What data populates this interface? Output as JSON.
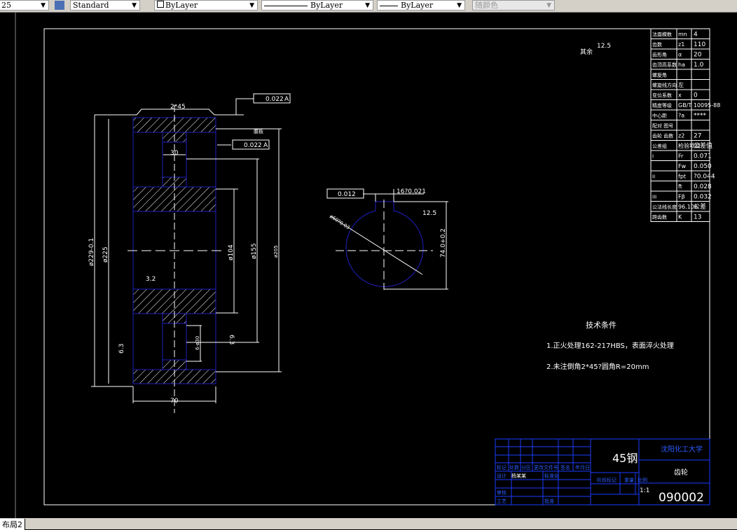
{
  "toolbar": {
    "lineweight_value": "25",
    "text_style": "Standard",
    "layer": "ByLayer",
    "linetype": "ByLayer",
    "lineweight": "ByLayer",
    "color": "随颜色"
  },
  "layout_tab": "布局2",
  "drawing": {
    "chamfer": "2*45",
    "tol1": "0.022",
    "datum": "A",
    "tol2": "0.022",
    "web_label": "腹板",
    "dim_30": "30",
    "dim_229": "ø229-0.1",
    "dim_225": "ø225",
    "dim_104": "ø104",
    "dim_155": "ø155",
    "dim_205": "ø205",
    "dim_70": "70",
    "dim_6": "6-ø30",
    "rough_32": "3.2",
    "rough_63a": "6.3",
    "rough_63b": "6.3",
    "rough_other": "其余",
    "rough_125": "12.5",
    "sym_tol": "0.012",
    "key_width": "16?0.021",
    "bore": "ø60?0.03",
    "key_depth": "74.0+0.2",
    "rough_125b": "12.5"
  },
  "params": [
    [
      "法面模数",
      "mn",
      "4"
    ],
    [
      "齿数",
      "z1",
      "110"
    ],
    [
      "齿形角",
      "α",
      "20"
    ],
    [
      "齿顶高系数",
      "ha",
      "1.0"
    ],
    [
      "螺旋角",
      "",
      ""
    ],
    [
      "螺旋线方向",
      "左",
      ""
    ],
    [
      "变位系数",
      "x",
      "0"
    ],
    [
      "精度等级",
      "GB/T 10095-88",
      ""
    ],
    [
      "中心距",
      "?a",
      "****"
    ],
    [
      "配对 图号",
      "",
      ""
    ],
    [
      "齿轮 齿数",
      "z2",
      "27"
    ],
    [
      "公差组",
      "检验项目",
      "公差值"
    ],
    [
      "I",
      "Fr",
      "0.071"
    ],
    [
      "",
      "Fw",
      "0.050"
    ],
    [
      "II",
      "fpt",
      "?0.044"
    ],
    [
      "",
      "ft",
      "0.028"
    ],
    [
      "III",
      "Fβ",
      "0.032"
    ],
    [
      "公法线长度",
      "96.106",
      "公差"
    ],
    [
      "跨齿数",
      "K",
      "13"
    ]
  ],
  "tech": {
    "title": "技术条件",
    "line1": "1.正火处理162-217HBS，表面淬火处理",
    "line2": "2.未注倒角2*45?圆角R=20mm"
  },
  "title_block": {
    "material": "45钢",
    "school": "沈阳化工大学",
    "part": "齿轮",
    "number": "090002",
    "scale": "1:1",
    "h_mark": "标记",
    "h_count": "处数",
    "h_zone": "分区",
    "h_doc": "更改文件号",
    "h_sign": "签名",
    "h_date": "年月日",
    "design": "设计",
    "designer": "杨某某",
    "standard": "标准化",
    "review": "审核",
    "process": "工艺",
    "approve": "批准",
    "stage": "阶段标记",
    "weight": "重量",
    "scale_label": "比例"
  }
}
